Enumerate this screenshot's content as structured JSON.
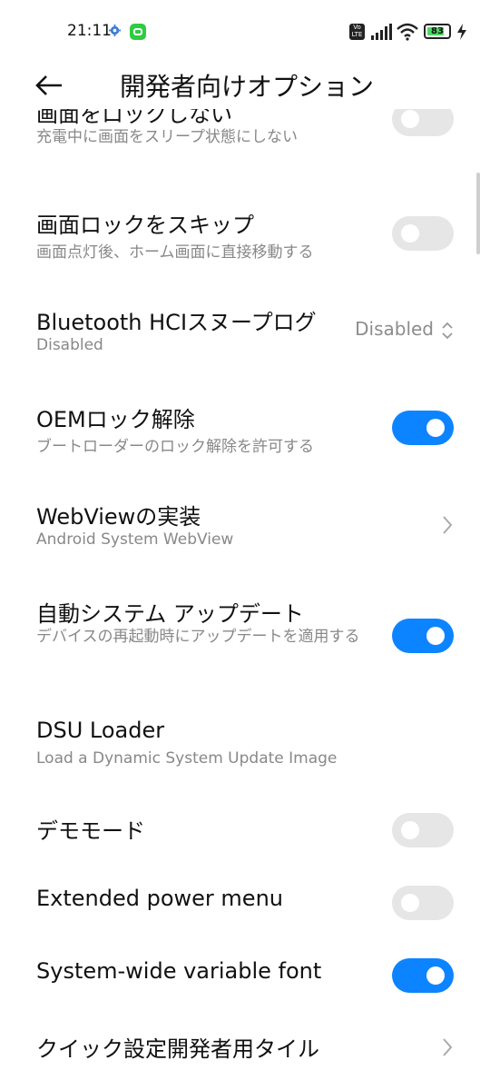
{
  "status_bar": {
    "time": "21:11",
    "battery": "83",
    "battery_level": 0.83,
    "network_badge": "Vo LTE",
    "icons": [
      "gear-icon",
      "app-notification-icon",
      "volte-icon",
      "signal-icon",
      "wifi-icon",
      "battery-icon",
      "charging-icon"
    ]
  },
  "header": {
    "title": "開発者向けオプション",
    "back_icon": "back-arrow-icon"
  },
  "colors": {
    "accent": "#0d84ff",
    "toggle_off": "#e6e6e6",
    "subtitle": "#888888",
    "battery_fill": "#4cd964"
  },
  "settings": [
    {
      "title": "画面をロックしない",
      "subtitle": "充電中に画面をスリープ状態にしない",
      "control": "toggle",
      "state": "off"
    },
    {
      "title": "画面ロックをスキップ",
      "subtitle": "画面点灯後、ホーム画面に直接移動する",
      "control": "toggle",
      "state": "off"
    },
    {
      "title": "Bluetooth HCIスヌープログ",
      "subtitle": "Disabled",
      "control": "select",
      "value": "Disabled"
    },
    {
      "title": "OEMロック解除",
      "subtitle": "ブートローダーのロック解除を許可する",
      "control": "toggle",
      "state": "on"
    },
    {
      "title": "WebViewの実装",
      "subtitle": "Android System WebView",
      "control": "chevron"
    },
    {
      "title": "自動システム アップデート",
      "subtitle": "デバイスの再起動時にアップデートを適用する",
      "control": "toggle",
      "state": "on"
    },
    {
      "title": "DSU Loader",
      "subtitle": "Load a Dynamic System Update Image",
      "control": "none"
    },
    {
      "title": "デモモード",
      "control": "toggle",
      "state": "off"
    },
    {
      "title": "Extended power menu",
      "control": "toggle",
      "state": "off"
    },
    {
      "title": "System-wide variable font",
      "control": "toggle",
      "state": "on"
    },
    {
      "title": "クイック設定開発者用タイル",
      "control": "chevron"
    }
  ]
}
